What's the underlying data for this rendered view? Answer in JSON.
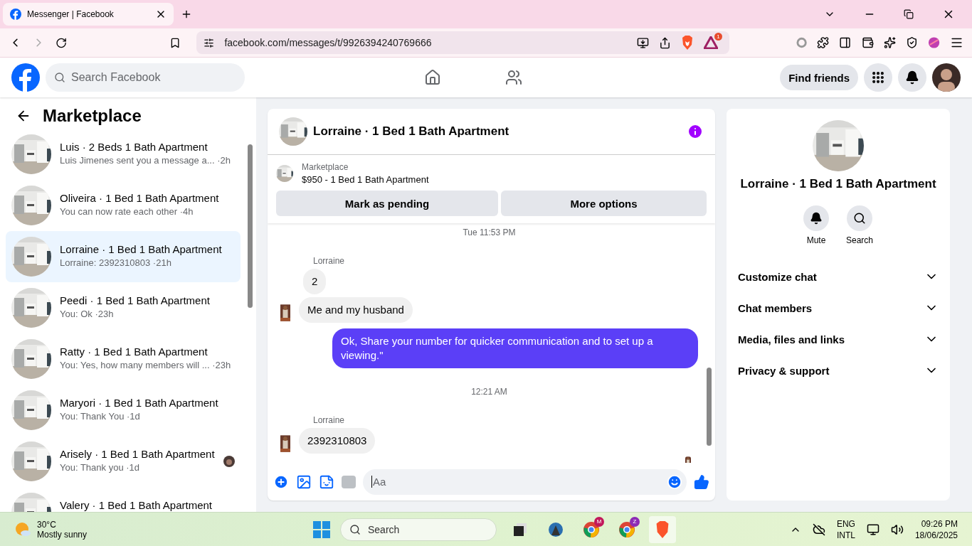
{
  "browser": {
    "tab_title": "Messenger | Facebook",
    "url": "facebook.com/messages/t/9926394240769666",
    "alert_count": "1"
  },
  "header": {
    "search_placeholder": "Search Facebook",
    "find_friends": "Find friends"
  },
  "sidebar": {
    "title": "Marketplace",
    "conversations": [
      {
        "name": "Luis · 2 Beds 1 Bath Apartment",
        "preview": "Luis Jimenes sent you a message a...",
        "time": "·2h",
        "selected": false,
        "read_receipt": false
      },
      {
        "name": "Oliveira · 1 Bed 1 Bath Apartment",
        "preview": "You can now rate each other",
        "time": "·4h",
        "selected": false,
        "read_receipt": false
      },
      {
        "name": "Lorraine · 1 Bed 1 Bath Apartment",
        "preview": "Lorraine: 2392310803",
        "time": "·21h",
        "selected": true,
        "read_receipt": false
      },
      {
        "name": "Peedi · 1 Bed 1 Bath Apartment",
        "preview": "You: Ok",
        "time": "·23h",
        "selected": false,
        "read_receipt": false
      },
      {
        "name": "Ratty · 1 Bed 1 Bath Apartment",
        "preview": "You: Yes, how many members will ...",
        "time": "·23h",
        "selected": false,
        "read_receipt": false
      },
      {
        "name": "Maryori · 1 Bed 1 Bath Apartment",
        "preview": "You: Thank You",
        "time": "·1d",
        "selected": false,
        "read_receipt": false
      },
      {
        "name": "Arisely · 1 Bed 1 Bath Apartment",
        "preview": "You: Thank you",
        "time": "·1d",
        "selected": false,
        "read_receipt": true
      },
      {
        "name": "Valery · 1 Bed 1 Bath Apartment",
        "selected": false,
        "read_receipt": false
      }
    ]
  },
  "chat": {
    "title": "Lorraine · 1 Bed 1 Bath Apartment",
    "listing": {
      "source": "Marketplace",
      "title": "$950 - 1 Bed 1 Bath Apartment"
    },
    "actions": [
      "Mark as pending",
      "More options"
    ],
    "messages": [
      {
        "kind": "time",
        "text": "Tue 11:53 PM"
      },
      {
        "kind": "sender",
        "text": "Lorraine"
      },
      {
        "kind": "incoming",
        "text": "2",
        "avatar": false
      },
      {
        "kind": "incoming",
        "text": "Me and my husband",
        "avatar": true
      },
      {
        "kind": "outgoing",
        "text": "Ok, Share your number for quicker communication and to set up a viewing.\""
      },
      {
        "kind": "time",
        "text": "12:21 AM"
      },
      {
        "kind": "sender",
        "text": "Lorraine"
      },
      {
        "kind": "incoming",
        "text": "2392310803",
        "avatar": true
      }
    ],
    "composer_placeholder": "Aa"
  },
  "details": {
    "title": "Lorraine · 1 Bed 1 Bath Apartment",
    "actions": [
      {
        "kind": "mute",
        "label": "Mute"
      },
      {
        "kind": "search",
        "label": "Search"
      }
    ],
    "sections": [
      "Customize chat",
      "Chat members",
      "Media, files and links",
      "Privacy & support"
    ]
  },
  "taskbar": {
    "temperature": "30°C",
    "weather": "Mostly sunny",
    "search_placeholder": "Search",
    "apps": [
      {
        "kind": "window",
        "active": false
      },
      {
        "kind": "bot",
        "active": false
      },
      {
        "kind": "chrome",
        "badge": "M",
        "active": false
      },
      {
        "kind": "chrome",
        "badge": "Z",
        "active": false
      },
      {
        "kind": "brave",
        "active": true
      }
    ],
    "language": "ENG",
    "layout": "INTL",
    "time": "09:26 PM",
    "date": "18/06/2025"
  }
}
